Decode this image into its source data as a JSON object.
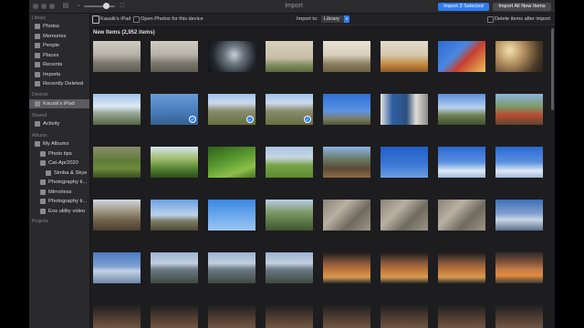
{
  "window": {
    "title": "Import",
    "import_selected_label": "Import 3 Selected",
    "import_all_label": "Import All New Items",
    "accent_color": "#2f7bf0"
  },
  "sidebar": {
    "library_header": "Library",
    "library_items": [
      {
        "label": "Photos",
        "icon": "photos-icon"
      },
      {
        "label": "Memories",
        "icon": "memories-icon"
      },
      {
        "label": "People",
        "icon": "people-icon"
      },
      {
        "label": "Places",
        "icon": "places-icon"
      },
      {
        "label": "Recents",
        "icon": "recents-icon"
      },
      {
        "label": "Imports",
        "icon": "imports-icon"
      },
      {
        "label": "Recently Deleted",
        "icon": "trash-icon"
      }
    ],
    "devices_header": "Devices",
    "device_item": {
      "label": "Kausik's iPad",
      "icon": "ipad-icon"
    },
    "shared_header": "Shared",
    "shared_item": {
      "label": "Activity",
      "icon": "cloud-icon"
    },
    "albums_header": "Albums",
    "album_items": [
      {
        "label": "My Albums",
        "icon": "folder-icon"
      },
      {
        "label": "Photo tips",
        "icon": "album-icon"
      },
      {
        "label": "Cat-Apr2020",
        "icon": "folder-icon"
      },
      {
        "label": "Simba & Skye",
        "icon": "album-icon"
      },
      {
        "label": "Photography ti...",
        "icon": "album-icon"
      },
      {
        "label": "Mirrorless",
        "icon": "album-icon"
      },
      {
        "label": "Photography ti...",
        "icon": "album-icon"
      },
      {
        "label": "Eos utility video",
        "icon": "album-icon"
      }
    ],
    "projects_header": "Projects"
  },
  "device_bar": {
    "device_name": "Kausik's iPad",
    "open_photos_label": "Open Photos for this device",
    "import_to_label": "Import to:",
    "import_to_value": "Library",
    "delete_after_label": "Delete items after import"
  },
  "grid": {
    "section_title": "New Items (2,952 items)",
    "checked_icon": "checkmark-icon",
    "rows": [
      [
        "misty-trees",
        "misty-trees",
        "night-forest-figure",
        "foggy-field",
        "farm-trees",
        "orange-field",
        "man-portrait",
        "bedroom-interior"
      ],
      [
        "mountain-landscape",
        "blue-blur",
        "village-fields",
        "village-fields",
        "blue-sky-terrain",
        "window-gate",
        "mountain-trees",
        "red-house-trees"
      ],
      [
        "terraces-stone",
        "terrace-trees",
        "green-terraces",
        "green-field",
        "wooden-structure",
        "blue-sky",
        "blue-sky-clouds",
        "blue-sky-clouds"
      ],
      [
        "stone-house",
        "hilltop-figure",
        "paraglider-sky",
        "hill-trees",
        "rocky-slope",
        "rocky-slope",
        "rocky-slope",
        "blue-mountains"
      ],
      [
        "distant-mountains",
        "mountain-range",
        "mountain-range",
        "mountain-range",
        "family-selfie",
        "family-selfie",
        "family-selfie",
        "woman-portrait"
      ],
      [
        "dark-portrait",
        "dark-portrait",
        "dark-portrait",
        "dark-portrait",
        "dark-portrait",
        "dark-portrait",
        "dark-portrait",
        "dark-portrait"
      ]
    ],
    "selected": [
      [
        1,
        1
      ],
      [
        1,
        2
      ],
      [
        1,
        3
      ]
    ]
  }
}
